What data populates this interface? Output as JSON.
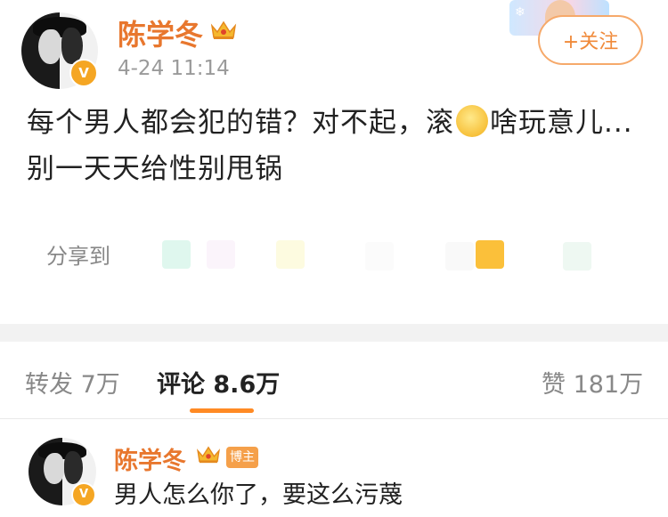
{
  "post": {
    "author": "陈学冬",
    "verified_mark": "V",
    "timestamp": "4-24 11:14",
    "follow_label": "+关注",
    "content_part1": "每个男人都会犯的错？对不起，滚",
    "content_part2": "啥玩意儿...别一天天给性别甩锅",
    "emoji_name": "thinking-face-emoji"
  },
  "share": {
    "label": "分享到",
    "icon_colors": [
      "#dff7ee",
      "#fbf4fb",
      "#fdfbe0",
      "#fbfbfb",
      "#f9f9f9",
      "#fbc03a",
      "#eef8f2"
    ]
  },
  "tabs": {
    "repost": "转发 7万",
    "comments": "评论 8.6万",
    "likes": "赞 181万"
  },
  "comment": {
    "author": "陈学冬",
    "badge": "博主",
    "text": "男人怎么你了，要这么污蔑"
  },
  "colors": {
    "accent": "#ff8a24",
    "name": "#e8772e",
    "divider": "#f2f2f2"
  }
}
